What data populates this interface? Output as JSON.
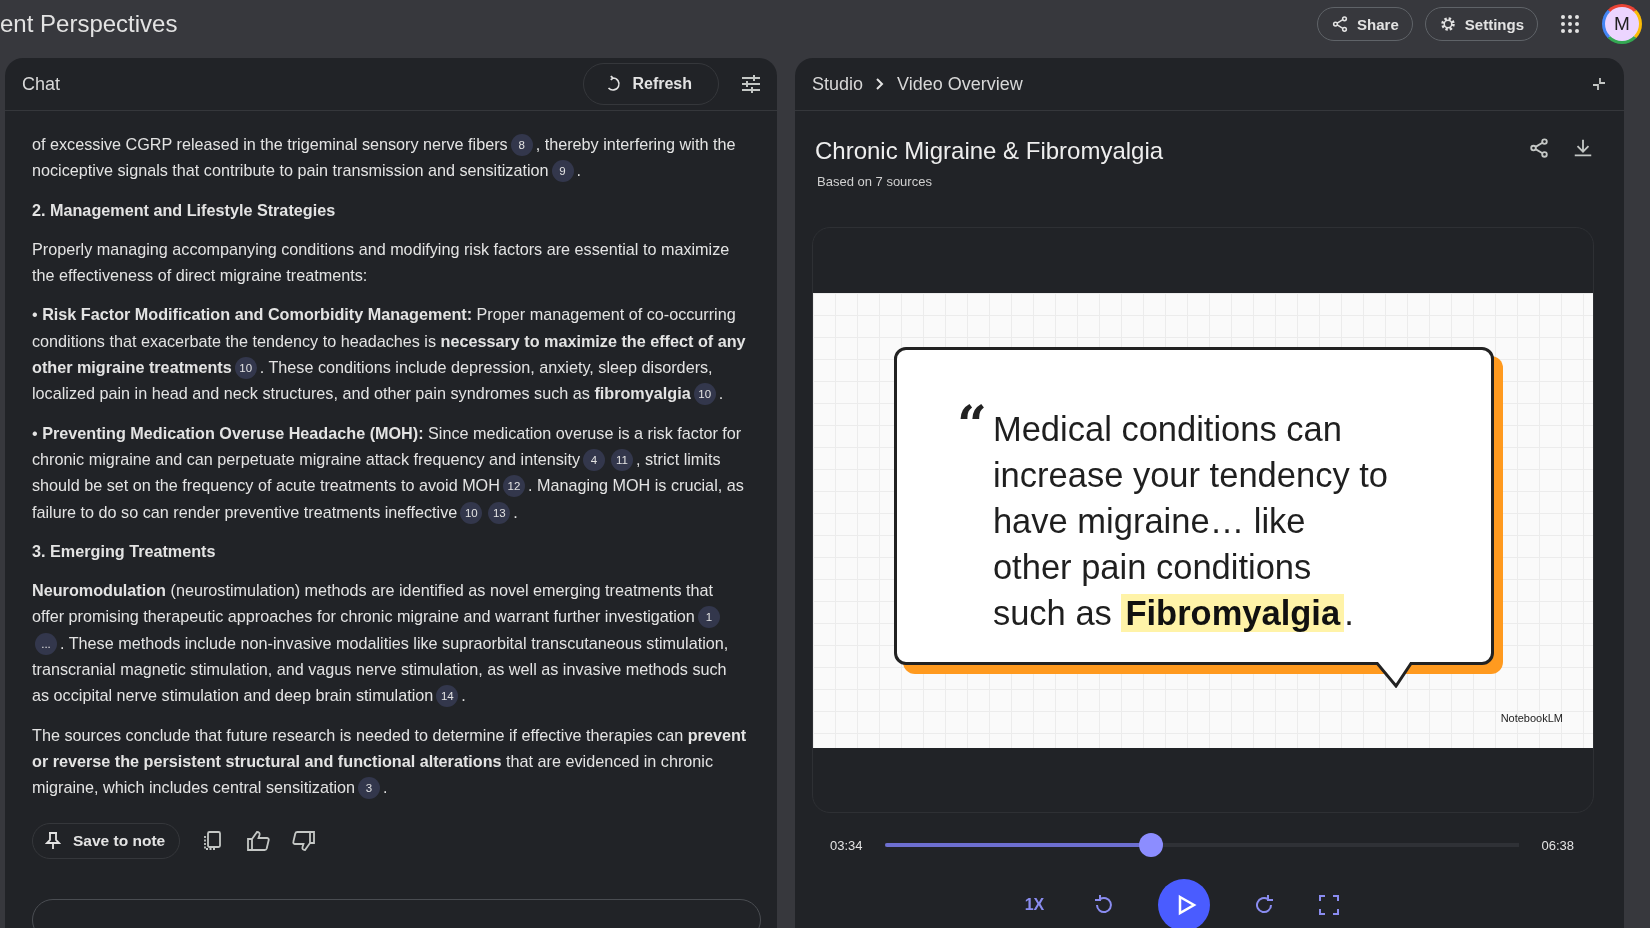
{
  "top_bar": {
    "title": "ent Perspectives",
    "share": "Share",
    "settings": "Settings",
    "avatar": "M"
  },
  "chat": {
    "title": "Chat",
    "refresh": "Refresh",
    "paragraphs": [
      {
        "kind": "text",
        "segments": [
          {
            "kind": "text",
            "text": "of excessive CGRP released in the trigeminal sensory nerve fibers"
          },
          {
            "kind": "cite",
            "text": "8"
          },
          {
            "kind": "text",
            "text": ", thereby interfering with the nociceptive signals that contribute to pain transmission and sensitization"
          },
          {
            "kind": "cite",
            "text": "9"
          },
          {
            "kind": "text",
            "text": "."
          }
        ]
      },
      {
        "kind": "heading",
        "segments": [
          {
            "kind": "text",
            "text": "2. Management and Lifestyle Strategies"
          }
        ]
      },
      {
        "kind": "text",
        "segments": [
          {
            "kind": "text",
            "text": "Properly managing accompanying conditions and modifying risk factors are essential to maximize the effectiveness of direct migraine treatments:"
          }
        ]
      },
      {
        "kind": "text",
        "segments": [
          {
            "kind": "text",
            "text": "• **Risk Factor Modification and Comorbidity Management:** Proper management of co-occurring conditions that exacerbate the tendency to headaches is **necessary to maximize the effect of any other migraine treatments**"
          },
          {
            "kind": "cite",
            "text": "10"
          },
          {
            "kind": "text",
            "text": ". These conditions include depression, anxiety, sleep disorders, localized pain in head and neck structures, and other pain syndromes such as **fibromyalgia**"
          },
          {
            "kind": "cite",
            "text": "10"
          },
          {
            "kind": "text",
            "text": "."
          }
        ]
      },
      {
        "kind": "text",
        "segments": [
          {
            "kind": "text",
            "text": "• **Preventing Medication Overuse Headache (MOH):** Since medication overuse is a risk factor for chronic migraine and can perpetuate migraine attack frequency and intensity"
          },
          {
            "kind": "cite",
            "text": "4"
          },
          {
            "kind": "cite",
            "text": "11"
          },
          {
            "kind": "text",
            "text": ", strict limits should be set on the frequency of acute treatments to avoid MOH"
          },
          {
            "kind": "cite",
            "text": "12"
          },
          {
            "kind": "text",
            "text": ". Managing MOH is crucial, as failure to do so can render preventive treatments ineffective"
          },
          {
            "kind": "cite",
            "text": "10"
          },
          {
            "kind": "cite",
            "text": "13"
          },
          {
            "kind": "text",
            "text": "."
          }
        ]
      },
      {
        "kind": "heading",
        "segments": [
          {
            "kind": "text",
            "text": "3. Emerging Treatments"
          }
        ]
      },
      {
        "kind": "text",
        "segments": [
          {
            "kind": "text",
            "text": "**Neuromodulation** (neurostimulation) methods are identified as novel emerging treatments that offer promising therapeutic approaches for chronic migraine and warrant further investigation"
          },
          {
            "kind": "cite",
            "text": "1"
          },
          {
            "kind": "cite",
            "text": "..."
          },
          {
            "kind": "text",
            "text": ". These methods include non-invasive modalities like supraorbital transcutaneous stimulation, transcranial magnetic stimulation, and vagus nerve stimulation, as well as invasive methods such as occipital nerve stimulation and deep brain stimulation"
          },
          {
            "kind": "cite",
            "text": "14"
          },
          {
            "kind": "text",
            "text": "."
          }
        ]
      },
      {
        "kind": "text",
        "segments": [
          {
            "kind": "text",
            "text": "The sources conclude that future research is needed to determine if effective therapies can **prevent or reverse the persistent structural and functional alterations** that are evidenced in chronic migraine, which includes central sensitization"
          },
          {
            "kind": "cite",
            "text": "3"
          },
          {
            "kind": "text",
            "text": "."
          }
        ]
      }
    ],
    "save_to_note": "Save to note"
  },
  "studio": {
    "crumbs": [
      "Studio",
      "Video Overview"
    ],
    "title": "Chronic Migraine & Fibromyalgia",
    "subtitle": "Based on 7 sources",
    "slide": {
      "quote_mark": "“",
      "quote": "Medical conditions can increase your tendency to have migraine… like other pain conditions such as",
      "highlight": "Fibromyalgia",
      "after": ".",
      "brand": "NotebookLM"
    },
    "player": {
      "elapsed": "03:34",
      "total": "06:38",
      "level": 0.42,
      "speed": "1X"
    }
  }
}
